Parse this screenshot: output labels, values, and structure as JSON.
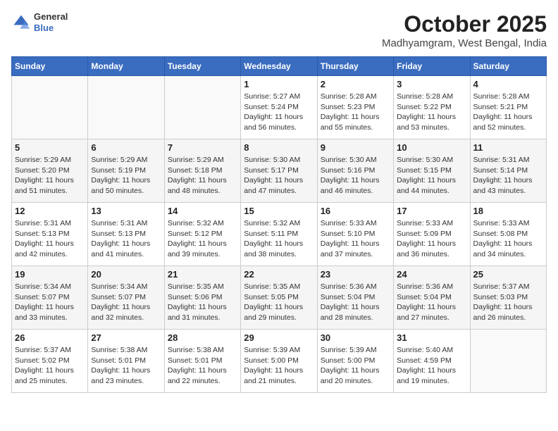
{
  "header": {
    "logo": {
      "general": "General",
      "blue": "Blue"
    },
    "title": "October 2025",
    "location": "Madhyamgram, West Bengal, India"
  },
  "weekdays": [
    "Sunday",
    "Monday",
    "Tuesday",
    "Wednesday",
    "Thursday",
    "Friday",
    "Saturday"
  ],
  "weeks": [
    [
      {
        "day": "",
        "sunrise": "",
        "sunset": "",
        "daylight": ""
      },
      {
        "day": "",
        "sunrise": "",
        "sunset": "",
        "daylight": ""
      },
      {
        "day": "",
        "sunrise": "",
        "sunset": "",
        "daylight": ""
      },
      {
        "day": "1",
        "sunrise": "Sunrise: 5:27 AM",
        "sunset": "Sunset: 5:24 PM",
        "daylight": "Daylight: 11 hours and 56 minutes."
      },
      {
        "day": "2",
        "sunrise": "Sunrise: 5:28 AM",
        "sunset": "Sunset: 5:23 PM",
        "daylight": "Daylight: 11 hours and 55 minutes."
      },
      {
        "day": "3",
        "sunrise": "Sunrise: 5:28 AM",
        "sunset": "Sunset: 5:22 PM",
        "daylight": "Daylight: 11 hours and 53 minutes."
      },
      {
        "day": "4",
        "sunrise": "Sunrise: 5:28 AM",
        "sunset": "Sunset: 5:21 PM",
        "daylight": "Daylight: 11 hours and 52 minutes."
      }
    ],
    [
      {
        "day": "5",
        "sunrise": "Sunrise: 5:29 AM",
        "sunset": "Sunset: 5:20 PM",
        "daylight": "Daylight: 11 hours and 51 minutes."
      },
      {
        "day": "6",
        "sunrise": "Sunrise: 5:29 AM",
        "sunset": "Sunset: 5:19 PM",
        "daylight": "Daylight: 11 hours and 50 minutes."
      },
      {
        "day": "7",
        "sunrise": "Sunrise: 5:29 AM",
        "sunset": "Sunset: 5:18 PM",
        "daylight": "Daylight: 11 hours and 48 minutes."
      },
      {
        "day": "8",
        "sunrise": "Sunrise: 5:30 AM",
        "sunset": "Sunset: 5:17 PM",
        "daylight": "Daylight: 11 hours and 47 minutes."
      },
      {
        "day": "9",
        "sunrise": "Sunrise: 5:30 AM",
        "sunset": "Sunset: 5:16 PM",
        "daylight": "Daylight: 11 hours and 46 minutes."
      },
      {
        "day": "10",
        "sunrise": "Sunrise: 5:30 AM",
        "sunset": "Sunset: 5:15 PM",
        "daylight": "Daylight: 11 hours and 44 minutes."
      },
      {
        "day": "11",
        "sunrise": "Sunrise: 5:31 AM",
        "sunset": "Sunset: 5:14 PM",
        "daylight": "Daylight: 11 hours and 43 minutes."
      }
    ],
    [
      {
        "day": "12",
        "sunrise": "Sunrise: 5:31 AM",
        "sunset": "Sunset: 5:13 PM",
        "daylight": "Daylight: 11 hours and 42 minutes."
      },
      {
        "day": "13",
        "sunrise": "Sunrise: 5:31 AM",
        "sunset": "Sunset: 5:13 PM",
        "daylight": "Daylight: 11 hours and 41 minutes."
      },
      {
        "day": "14",
        "sunrise": "Sunrise: 5:32 AM",
        "sunset": "Sunset: 5:12 PM",
        "daylight": "Daylight: 11 hours and 39 minutes."
      },
      {
        "day": "15",
        "sunrise": "Sunrise: 5:32 AM",
        "sunset": "Sunset: 5:11 PM",
        "daylight": "Daylight: 11 hours and 38 minutes."
      },
      {
        "day": "16",
        "sunrise": "Sunrise: 5:33 AM",
        "sunset": "Sunset: 5:10 PM",
        "daylight": "Daylight: 11 hours and 37 minutes."
      },
      {
        "day": "17",
        "sunrise": "Sunrise: 5:33 AM",
        "sunset": "Sunset: 5:09 PM",
        "daylight": "Daylight: 11 hours and 36 minutes."
      },
      {
        "day": "18",
        "sunrise": "Sunrise: 5:33 AM",
        "sunset": "Sunset: 5:08 PM",
        "daylight": "Daylight: 11 hours and 34 minutes."
      }
    ],
    [
      {
        "day": "19",
        "sunrise": "Sunrise: 5:34 AM",
        "sunset": "Sunset: 5:07 PM",
        "daylight": "Daylight: 11 hours and 33 minutes."
      },
      {
        "day": "20",
        "sunrise": "Sunrise: 5:34 AM",
        "sunset": "Sunset: 5:07 PM",
        "daylight": "Daylight: 11 hours and 32 minutes."
      },
      {
        "day": "21",
        "sunrise": "Sunrise: 5:35 AM",
        "sunset": "Sunset: 5:06 PM",
        "daylight": "Daylight: 11 hours and 31 minutes."
      },
      {
        "day": "22",
        "sunrise": "Sunrise: 5:35 AM",
        "sunset": "Sunset: 5:05 PM",
        "daylight": "Daylight: 11 hours and 29 minutes."
      },
      {
        "day": "23",
        "sunrise": "Sunrise: 5:36 AM",
        "sunset": "Sunset: 5:04 PM",
        "daylight": "Daylight: 11 hours and 28 minutes."
      },
      {
        "day": "24",
        "sunrise": "Sunrise: 5:36 AM",
        "sunset": "Sunset: 5:04 PM",
        "daylight": "Daylight: 11 hours and 27 minutes."
      },
      {
        "day": "25",
        "sunrise": "Sunrise: 5:37 AM",
        "sunset": "Sunset: 5:03 PM",
        "daylight": "Daylight: 11 hours and 26 minutes."
      }
    ],
    [
      {
        "day": "26",
        "sunrise": "Sunrise: 5:37 AM",
        "sunset": "Sunset: 5:02 PM",
        "daylight": "Daylight: 11 hours and 25 minutes."
      },
      {
        "day": "27",
        "sunrise": "Sunrise: 5:38 AM",
        "sunset": "Sunset: 5:01 PM",
        "daylight": "Daylight: 11 hours and 23 minutes."
      },
      {
        "day": "28",
        "sunrise": "Sunrise: 5:38 AM",
        "sunset": "Sunset: 5:01 PM",
        "daylight": "Daylight: 11 hours and 22 minutes."
      },
      {
        "day": "29",
        "sunrise": "Sunrise: 5:39 AM",
        "sunset": "Sunset: 5:00 PM",
        "daylight": "Daylight: 11 hours and 21 minutes."
      },
      {
        "day": "30",
        "sunrise": "Sunrise: 5:39 AM",
        "sunset": "Sunset: 5:00 PM",
        "daylight": "Daylight: 11 hours and 20 minutes."
      },
      {
        "day": "31",
        "sunrise": "Sunrise: 5:40 AM",
        "sunset": "Sunset: 4:59 PM",
        "daylight": "Daylight: 11 hours and 19 minutes."
      },
      {
        "day": "",
        "sunrise": "",
        "sunset": "",
        "daylight": ""
      }
    ]
  ]
}
